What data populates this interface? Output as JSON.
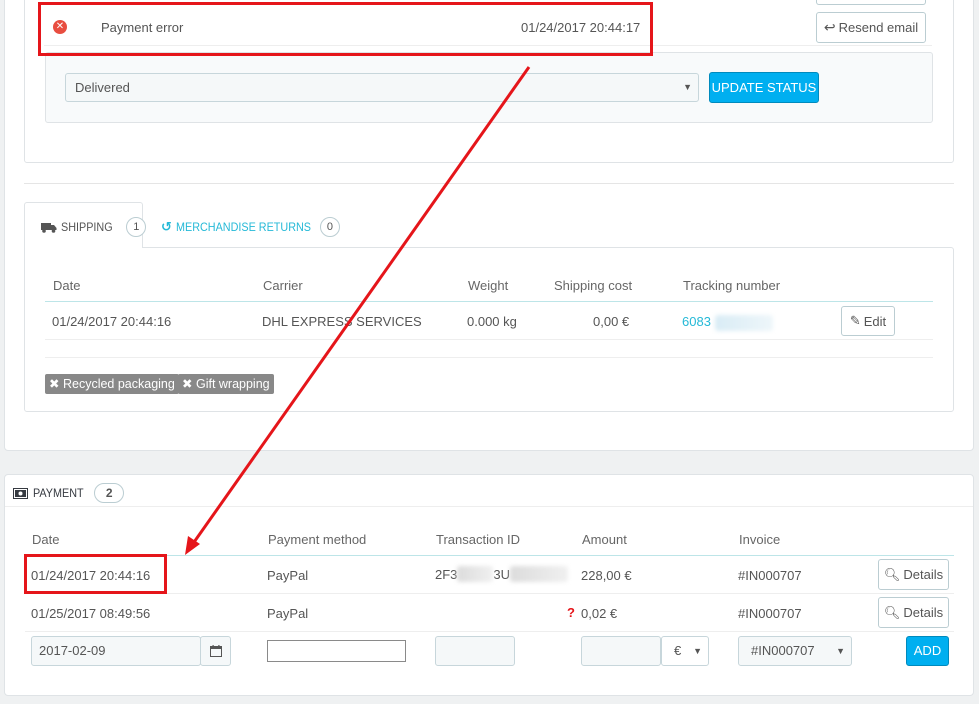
{
  "order_history": {
    "status": "Payment error",
    "date": "01/24/2017 20:44:17",
    "resend_label": "Resend email",
    "selected_status": "Delivered",
    "update_label": "UPDATE STATUS"
  },
  "tabs": {
    "shipping": {
      "label": "SHIPPING",
      "count": "1"
    },
    "returns": {
      "label": "MERCHANDISE RETURNS",
      "count": "0"
    }
  },
  "shipping": {
    "headers": [
      "Date",
      "Carrier",
      "Weight",
      "Shipping cost",
      "Tracking number"
    ],
    "row": {
      "date": "01/24/2017 20:44:16",
      "carrier": "DHL EXPRESS SERVICES",
      "weight": "0.000 kg",
      "cost": "0,00 €",
      "tracking": "6083"
    },
    "edit_label": "Edit",
    "tags": [
      "Recycled packaging",
      "Gift wrapping"
    ]
  },
  "payment": {
    "title": "PAYMENT",
    "count": "2",
    "headers": [
      "Date",
      "Payment method",
      "Transaction ID",
      "Amount",
      "Invoice"
    ],
    "rows": [
      {
        "date": "01/24/2017 20:44:16",
        "method": "PayPal",
        "txn_a": "2F3",
        "txn_b": "3U",
        "amount": "228,00 €",
        "invoice": "#IN000707",
        "warn": ""
      },
      {
        "date": "01/25/2017 08:49:56",
        "method": "PayPal",
        "txn_a": "",
        "txn_b": "",
        "amount": "0,02 €",
        "invoice": "#IN000707",
        "warn": "?"
      }
    ],
    "details_label": "Details",
    "new_row": {
      "date": "2017-02-09",
      "currency": "€",
      "invoice": "#IN000707",
      "add_label": "ADD"
    }
  },
  "colors": {
    "accent": "#00aff0",
    "link": "#25b9d7",
    "annotation": "#e5151a",
    "error": "#e84e40"
  }
}
